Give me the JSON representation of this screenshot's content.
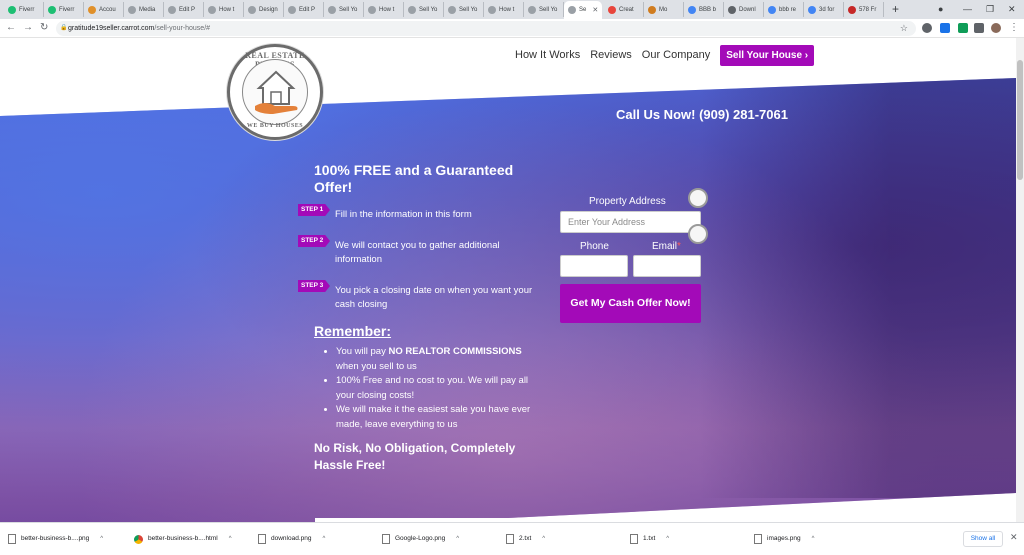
{
  "browser": {
    "tabs": [
      {
        "label": "Fiverr",
        "color": "#1dbf73"
      },
      {
        "label": "Fiverr",
        "color": "#1dbf73"
      },
      {
        "label": "Accou",
        "color": "#e0902a"
      },
      {
        "label": "Media",
        "color": "#9aa0a6"
      },
      {
        "label": "Edit P",
        "color": "#9aa0a6"
      },
      {
        "label": "How t",
        "color": "#9aa0a6"
      },
      {
        "label": "Design",
        "color": "#9aa0a6"
      },
      {
        "label": "Edit P",
        "color": "#9aa0a6"
      },
      {
        "label": "Sell Yo",
        "color": "#9aa0a6"
      },
      {
        "label": "How t",
        "color": "#9aa0a6"
      },
      {
        "label": "Sell Yo",
        "color": "#9aa0a6"
      },
      {
        "label": "Sell Yo",
        "color": "#9aa0a6"
      },
      {
        "label": "How t",
        "color": "#9aa0a6"
      },
      {
        "label": "Sell Yo",
        "color": "#9aa0a6"
      },
      {
        "label": "Se",
        "color": "#9aa0a6"
      },
      {
        "label": "Creat",
        "color": "#e8453c"
      },
      {
        "label": "Mo",
        "color": "#d07c1f"
      },
      {
        "label": "BBB b",
        "color": "#4285f4"
      },
      {
        "label": "Downl",
        "color": "#5f6368"
      },
      {
        "label": "bbb re",
        "color": "#4285f4"
      },
      {
        "label": "3d for",
        "color": "#4285f4"
      },
      {
        "label": "578 Fr",
        "color": "#c62828"
      }
    ],
    "new_tab": "+",
    "window_buttons": {
      "minimize": "—",
      "maximize": "❐",
      "close": "✕"
    },
    "url_host": "gratitude19seller.carrot.com",
    "url_path": "/sell-your-house/#"
  },
  "nav": {
    "items": [
      "How It Works",
      "Reviews",
      "Our Company"
    ],
    "cta": "Sell Your House ›"
  },
  "logo": {
    "top_text": "REAL ESTATE PEOPLES",
    "bottom_text": "WE BUY HOUSES"
  },
  "call_us": "Call Us Now! (909) 281-7061",
  "headline": "100% FREE and a Guaranteed Offer!",
  "steps": [
    {
      "badge": "STEP 1",
      "text": "Fill in the information in this form"
    },
    {
      "badge": "STEP 2",
      "text": "We will contact you to gather additional information"
    },
    {
      "badge": "STEP 3",
      "text": "You pick a closing date on when you want your cash closing"
    }
  ],
  "remember": {
    "title": "Remember:",
    "items": [
      {
        "pre": "You will pay ",
        "bold": "NO REALTOR COMMISSIONS",
        "post": " when you sell to us"
      },
      {
        "pre": "100% Free and no cost to you. We will pay all your closing costs!",
        "bold": "",
        "post": ""
      },
      {
        "pre": "We will make it the easiest sale you have ever made, leave everything to us",
        "bold": "",
        "post": ""
      }
    ]
  },
  "closing": "No Risk, No Obligation, Completely Hassle Free!",
  "form": {
    "address_label": "Property Address",
    "address_placeholder": "Enter Your Address",
    "phone_label": "Phone",
    "email_label": "Email",
    "required_mark": "*",
    "submit_label": "Get My Cash Offer Now!"
  },
  "downloads": {
    "items": [
      {
        "name": "better-business-b....png",
        "type": "file"
      },
      {
        "name": "better-business-b....html",
        "type": "chrome"
      },
      {
        "name": "download.png",
        "type": "file"
      },
      {
        "name": "Google-Logo.png",
        "type": "file"
      },
      {
        "name": "2.txt",
        "type": "file"
      },
      {
        "name": "1.txt",
        "type": "file"
      },
      {
        "name": "images.png",
        "type": "file"
      }
    ],
    "show_all": "Show all",
    "close": "✕",
    "caret": "^"
  },
  "colors": {
    "accent": "#a30ab8",
    "hero_blue": "#4a6fe6",
    "hero_purple": "#6f4aa6"
  }
}
